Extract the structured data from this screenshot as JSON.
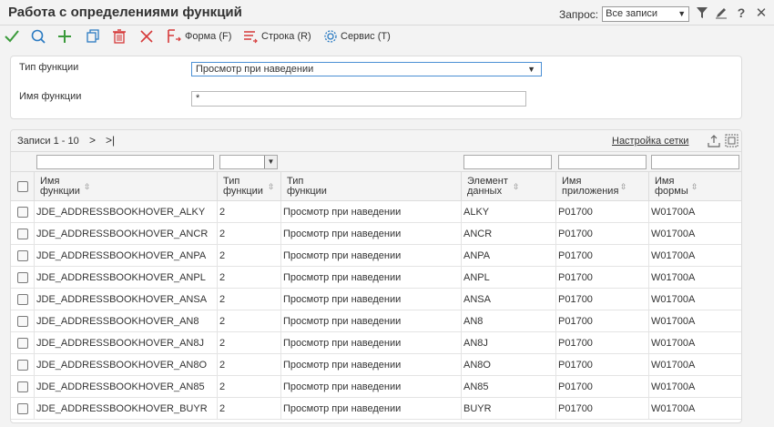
{
  "window": {
    "title": "Работа с определениями функций",
    "query_label": "Запрос:",
    "query_value": "Все записи"
  },
  "toolbar": {
    "form_label": "Форма (F)",
    "row_label": "Строка (R)",
    "service_label": "Сервис (T)"
  },
  "form": {
    "type_label": "Тип функции",
    "type_value": "Просмотр при наведении",
    "name_label": "Имя функции",
    "name_value": "*"
  },
  "grid": {
    "records": "Записи 1 - 10",
    "settings_link": "Настройка сетки",
    "columns": [
      {
        "line1": "Имя",
        "line2": "функции"
      },
      {
        "line1": "Тип",
        "line2": "функции"
      },
      {
        "line1": "Тип",
        "line2": "функции"
      },
      {
        "line1": "Элемент",
        "line2": "данных"
      },
      {
        "line1": "Имя",
        "line2": "приложения"
      },
      {
        "line1": "Имя",
        "line2": "формы"
      }
    ],
    "rows": [
      [
        "JDE_ADDRESSBOOKHOVER_ALKY",
        "2",
        "Просмотр при наведении",
        "ALKY",
        "P01700",
        "W01700A"
      ],
      [
        "JDE_ADDRESSBOOKHOVER_ANCR",
        "2",
        "Просмотр при наведении",
        "ANCR",
        "P01700",
        "W01700A"
      ],
      [
        "JDE_ADDRESSBOOKHOVER_ANPA",
        "2",
        "Просмотр при наведении",
        "ANPA",
        "P01700",
        "W01700A"
      ],
      [
        "JDE_ADDRESSBOOKHOVER_ANPL",
        "2",
        "Просмотр при наведении",
        "ANPL",
        "P01700",
        "W01700A"
      ],
      [
        "JDE_ADDRESSBOOKHOVER_ANSA",
        "2",
        "Просмотр при наведении",
        "ANSA",
        "P01700",
        "W01700A"
      ],
      [
        "JDE_ADDRESSBOOKHOVER_AN8",
        "2",
        "Просмотр при наведении",
        "AN8",
        "P01700",
        "W01700A"
      ],
      [
        "JDE_ADDRESSBOOKHOVER_AN8J",
        "2",
        "Просмотр при наведении",
        "AN8J",
        "P01700",
        "W01700A"
      ],
      [
        "JDE_ADDRESSBOOKHOVER_AN8O",
        "2",
        "Просмотр при наведении",
        "AN8O",
        "P01700",
        "W01700A"
      ],
      [
        "JDE_ADDRESSBOOKHOVER_AN85",
        "2",
        "Просмотр при наведении",
        "AN85",
        "P01700",
        "W01700A"
      ],
      [
        "JDE_ADDRESSBOOKHOVER_BUYR",
        "2",
        "Просмотр при наведении",
        "BUYR",
        "P01700",
        "W01700A"
      ]
    ]
  },
  "colors": {
    "accent": "#4a8fd4",
    "ok_green": "#3a9a3a",
    "delete_red": "#d63a3a"
  },
  "icons": [
    "check-icon",
    "search-icon",
    "add-icon",
    "copy-icon",
    "trash-icon",
    "close-icon",
    "form-icon",
    "row-icon",
    "gear-icon",
    "filter-icon",
    "edit-icon",
    "help-icon",
    "close-window-icon",
    "export-icon",
    "expand-icon"
  ]
}
